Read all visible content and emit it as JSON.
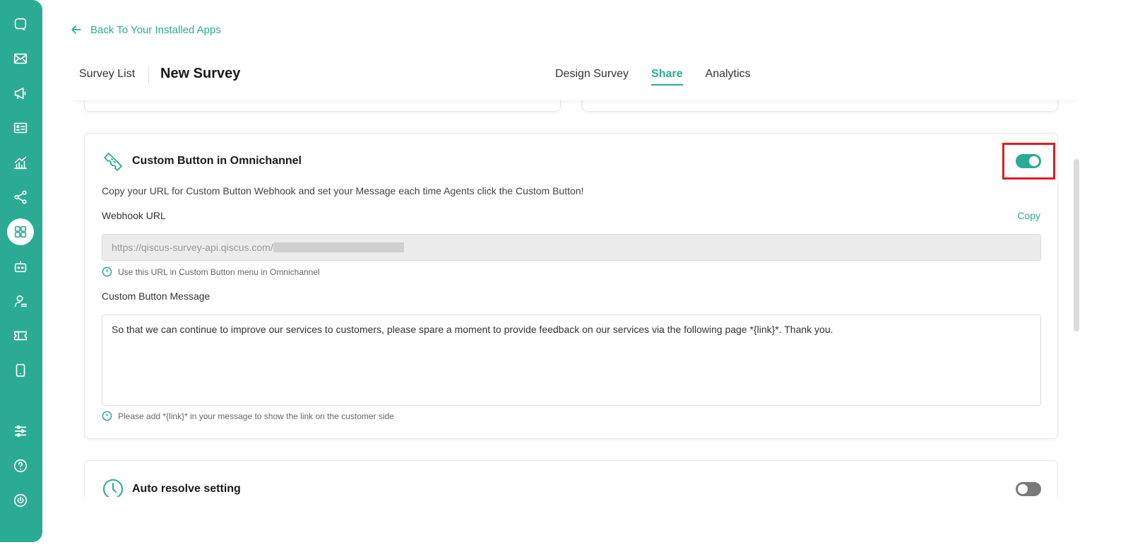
{
  "sidebar": {
    "items": [
      {
        "icon": "chat-icon",
        "active": false
      },
      {
        "icon": "mail-icon",
        "active": false
      },
      {
        "icon": "megaphone-icon",
        "active": false
      },
      {
        "icon": "contact-card-icon",
        "active": false
      },
      {
        "icon": "analytics-chart-icon",
        "active": false
      },
      {
        "icon": "share-nodes-icon",
        "active": false
      },
      {
        "icon": "apps-grid-icon",
        "active": true
      },
      {
        "icon": "robot-icon",
        "active": false
      },
      {
        "icon": "agent-icon",
        "active": false
      },
      {
        "icon": "ticket-icon",
        "active": false
      },
      {
        "icon": "mobile-icon",
        "active": false
      },
      {
        "icon": "settings-sliders-icon",
        "active": false
      },
      {
        "icon": "help-icon",
        "active": false
      },
      {
        "icon": "power-icon",
        "active": false
      }
    ]
  },
  "header": {
    "back_label": "Back To Your Installed Apps",
    "survey_list_label": "Survey List",
    "survey_name": "New Survey",
    "tabs": [
      {
        "label": "Design Survey",
        "active": false
      },
      {
        "label": "Share",
        "active": true
      },
      {
        "label": "Analytics",
        "active": false
      }
    ]
  },
  "custom_button_card": {
    "title": "Custom Button in Omnichannel",
    "description": "Copy your URL for Custom Button Webhook and set your Message each time Agents click the Custom Button!",
    "enabled": true,
    "webhook_label": "Webhook URL",
    "copy_label": "Copy",
    "webhook_url": "https://qiscus-survey-api.qiscus.com/",
    "webhook_hint": "Use this URL in Custom Button menu in Omnichannel",
    "message_label": "Custom Button Message",
    "message_value": "So that we can continue to improve our services to customers, please spare a moment to provide feedback on our services via the following page *{link}*. Thank you.",
    "message_hint": "Please add *{link}* in your message to show the link on the customer side"
  },
  "auto_resolve_card": {
    "title": "Auto resolve setting",
    "enabled": false
  },
  "colors": {
    "accent": "#2bab94",
    "highlight": "#e01b24"
  }
}
